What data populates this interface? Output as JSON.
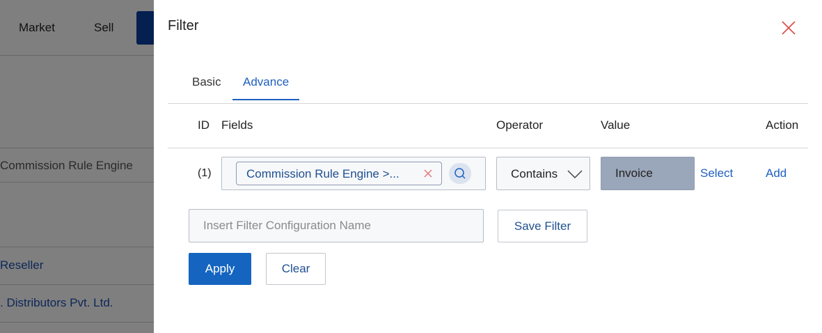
{
  "background": {
    "nav": {
      "market": "Market",
      "sell": "Sell"
    },
    "rows": {
      "commission": "Commission Rule Engine",
      "reseller": "Reseller",
      "distributors": ". Distributors Pvt. Ltd."
    }
  },
  "drawer": {
    "title": "Filter",
    "tabs": {
      "basic": "Basic",
      "advance": "Advance"
    },
    "columns": {
      "id": "ID",
      "fields": "Fields",
      "operator": "Operator",
      "value": "Value",
      "action": "Action"
    },
    "row": {
      "id": "(1)",
      "field_chip": "Commission Rule Engine >...",
      "operator": "Contains",
      "value": "Invoice",
      "select_label": "Select",
      "add_label": "Add"
    },
    "config": {
      "placeholder": "Insert Filter Configuration Name",
      "value": ""
    },
    "buttons": {
      "save_filter": "Save Filter",
      "apply": "Apply",
      "clear": "Clear"
    }
  },
  "colors": {
    "accent": "#1f5fbf",
    "apply_bg": "#1565c0",
    "value_field_bg": "#9aa6b9",
    "close_icon": "#d9534f",
    "chip_x": "#e57373"
  },
  "icons": {
    "close": "close-icon",
    "chip_remove": "remove-icon",
    "search": "search-icon",
    "operator_dropdown": "chevron-down-icon"
  }
}
